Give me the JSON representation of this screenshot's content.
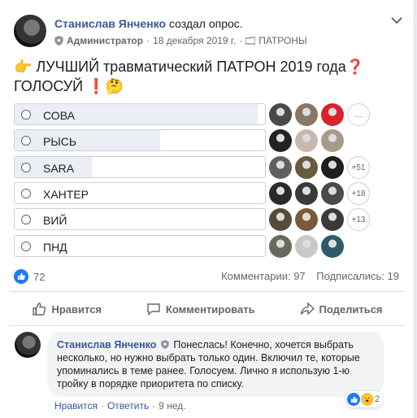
{
  "post": {
    "author": "Станислав Янченко",
    "action": "создал опрос.",
    "role": "Администратор",
    "date": "18 декабря 2019 г.",
    "group": "ПАТРОНЫ",
    "text_line1": "👉 ЛУЧШИЙ травматический ПАТРОН 2019 года❓",
    "text_line2": "ГОЛОСУЙ ❗🤔"
  },
  "poll": {
    "options": [
      {
        "label": "СОВА",
        "votes_share": 0.97,
        "more": "...",
        "voter_colors": [
          "#4a4a4a",
          "#8b7765",
          "#d9232c"
        ]
      },
      {
        "label": "РЫСЬ",
        "votes_share": 0.58,
        "more": "",
        "voter_colors": [
          "#222222",
          "#c8b8b0",
          "#a89a88"
        ]
      },
      {
        "label": "SARA",
        "votes_share": 0.31,
        "more": "+51",
        "voter_colors": [
          "#606060",
          "#6b5a42",
          "#1e1e1e"
        ]
      },
      {
        "label": "ХАНТЕР",
        "votes_share": 0.0,
        "more": "+18",
        "voter_colors": [
          "#2a2a2a",
          "#3a3a3a",
          "#4a4a4a"
        ]
      },
      {
        "label": "ВИЙ",
        "votes_share": 0.0,
        "more": "+13",
        "voter_colors": [
          "#5a4a3a",
          "#7a5a3a",
          "#3a3a3a"
        ]
      },
      {
        "label": "ПНД",
        "votes_share": 0.0,
        "more": "",
        "voter_colors": [
          "#6a6a5a",
          "#c8c8c8",
          "#2e5a6a"
        ]
      }
    ]
  },
  "stats": {
    "likes": "72",
    "comments": "Комментарии: 97",
    "subscribers": "Подписались: 19"
  },
  "actions": {
    "like": "Нравится",
    "comment": "Комментировать",
    "share": "Поделиться"
  },
  "comment": {
    "author": "Станислав Янченко",
    "text": "Понеслась! Конечно, хочется выбрать несколько, но нужно выбрать только один. Включил те, которые упоминались в теме ранее. Голосуем. Лично я использую 1-ю тройку в порядке приоритета по списку.",
    "like_link": "Нравится",
    "reply_link": "Ответить",
    "time": "9 нед.",
    "reactions_count": "2"
  },
  "colors": {
    "link": "#385898",
    "like_blue": "#2078f4",
    "poll_fill": "#ebeef4"
  }
}
